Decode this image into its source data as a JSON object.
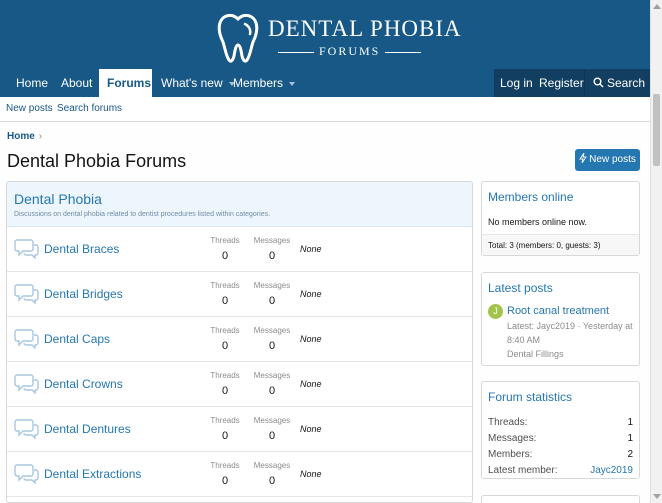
{
  "logo": {
    "title": "DENTAL PHOBIA",
    "subtitle": "FORUMS"
  },
  "nav": {
    "tabs": [
      {
        "label": "Home"
      },
      {
        "label": "About"
      },
      {
        "label": "Forums"
      },
      {
        "label": "What's new"
      },
      {
        "label": "Members"
      }
    ],
    "login": "Log in",
    "register": "Register",
    "search": "Search"
  },
  "subnav": {
    "new_posts": "New posts",
    "search_forums": "Search forums"
  },
  "breadcrumb": {
    "home": "Home",
    "separator": "›"
  },
  "page": {
    "title": "Dental Phobia Forums",
    "new_posts_button": "New posts"
  },
  "category": {
    "title": "Dental Phobia",
    "description": "Discussions on dental phobia related to dentist procedures listed within categories.",
    "nodes": [
      {
        "title": "Dental Braces",
        "threads_label": "Threads",
        "threads": "0",
        "messages_label": "Messages",
        "messages": "0",
        "latest": "None"
      },
      {
        "title": "Dental Bridges",
        "threads_label": "Threads",
        "threads": "0",
        "messages_label": "Messages",
        "messages": "0",
        "latest": "None"
      },
      {
        "title": "Dental Caps",
        "threads_label": "Threads",
        "threads": "0",
        "messages_label": "Messages",
        "messages": "0",
        "latest": "None"
      },
      {
        "title": "Dental Crowns",
        "threads_label": "Threads",
        "threads": "0",
        "messages_label": "Messages",
        "messages": "0",
        "latest": "None"
      },
      {
        "title": "Dental Dentures",
        "threads_label": "Threads",
        "threads": "0",
        "messages_label": "Messages",
        "messages": "0",
        "latest": "None"
      },
      {
        "title": "Dental Extractions",
        "threads_label": "Threads",
        "threads": "0",
        "messages_label": "Messages",
        "messages": "0",
        "latest": "None"
      }
    ]
  },
  "sidebar": {
    "members_online": {
      "title": "Members online",
      "status": "No members online now.",
      "total": "Total: 3 (members: 0, guests: 3)"
    },
    "latest_posts": {
      "title": "Latest posts",
      "avatar_letter": "J",
      "post_title": "Root canal treatment",
      "meta_line1": "Latest: Jayc2019 · Yesterday at",
      "meta_line2": "8:40 AM",
      "forum": "Dental Fillings"
    },
    "forum_statistics": {
      "title": "Forum statistics",
      "rows": [
        {
          "label": "Threads:",
          "value": "1"
        },
        {
          "label": "Messages:",
          "value": "1"
        },
        {
          "label": "Members:",
          "value": "2"
        },
        {
          "label": "Latest member:",
          "value": "Jayc2019"
        }
      ]
    }
  },
  "colors": {
    "header_bg": "#185886",
    "accent": "#2577b1",
    "nav_right_bg": "#123f61",
    "category_bg": "#edf6fd"
  }
}
